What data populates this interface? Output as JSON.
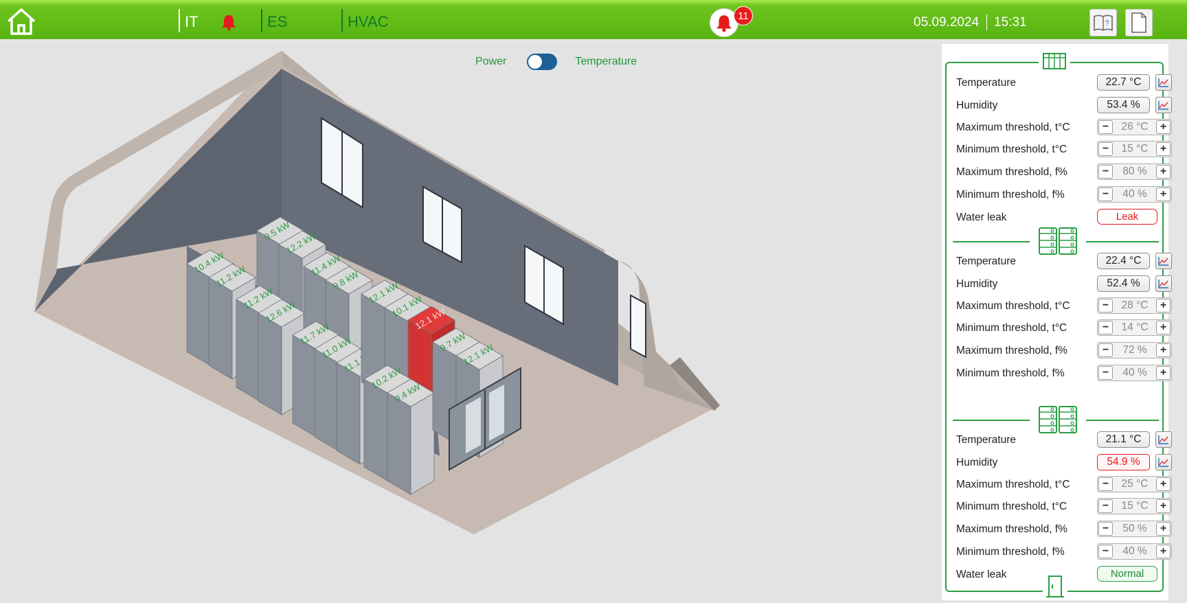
{
  "topbar": {
    "nav": [
      {
        "label": "IT",
        "color": "#ffffff"
      },
      {
        "label": "ES",
        "color": "#127a2a"
      },
      {
        "label": "HVAC",
        "color": "#127a2a"
      }
    ],
    "alarm_count": "11",
    "date": "05.09.2024",
    "time": "15:31",
    "icons": {
      "home": "home-icon",
      "alarm": "bell-icon",
      "help": "help-book-icon",
      "report": "document-icon"
    }
  },
  "view_toggle": {
    "left_label": "Power",
    "right_label": "Temperature",
    "state": "power"
  },
  "racks": [
    {
      "id": "r1",
      "label": "10.4 kW",
      "alert": false
    },
    {
      "id": "r2",
      "label": "11.2 kW",
      "alert": false
    },
    {
      "id": "r3",
      "label": "9.5 kW",
      "alert": false
    },
    {
      "id": "r4",
      "label": "12.2 kW",
      "alert": false
    },
    {
      "id": "r5",
      "label": "11.2 kW",
      "alert": false
    },
    {
      "id": "r6",
      "label": "12.6 kW",
      "alert": false
    },
    {
      "id": "r7",
      "label": "11.4 kW",
      "alert": false
    },
    {
      "id": "r8",
      "label": "9.8 kW",
      "alert": false
    },
    {
      "id": "r9",
      "label": "11.7 kW",
      "alert": false
    },
    {
      "id": "r10",
      "label": "11.0 kW",
      "alert": false
    },
    {
      "id": "r11",
      "label": "11.1 kW",
      "alert": false
    },
    {
      "id": "r12",
      "label": "12.1 kW",
      "alert": false
    },
    {
      "id": "r13",
      "label": "10.1 kW",
      "alert": false
    },
    {
      "id": "r14",
      "label": "12.1 kW",
      "alert": true
    },
    {
      "id": "r15",
      "label": "10.2 kW",
      "alert": false
    },
    {
      "id": "r16",
      "label": "9.4 kW",
      "alert": false
    },
    {
      "id": "r17",
      "label": "9.7 kW",
      "alert": false
    },
    {
      "id": "r18",
      "label": "12.1 kW",
      "alert": false
    }
  ],
  "panel": {
    "sections": [
      {
        "icon": "room-grid-icon",
        "temperature": "22.7 °C",
        "humidity": "53.4 %",
        "humidity_alert": false,
        "max_t": "26 °C",
        "min_t": "15 °C",
        "max_h": "80 %",
        "min_h": "40 %",
        "water_leak": "Leak",
        "leak_alert": true
      },
      {
        "icon": "rack-pair-icon",
        "temperature": "22.4 °C",
        "humidity": "52.4 %",
        "humidity_alert": false,
        "max_t": "28 °C",
        "min_t": "14 °C",
        "max_h": "72 %",
        "min_h": "40 %"
      },
      {
        "icon": "rack-pair-icon",
        "temperature": "21.1 °C",
        "humidity": "54.9 %",
        "humidity_alert": true,
        "max_t": "25 °C",
        "min_t": "15 °C",
        "max_h": "50 %",
        "min_h": "40 %",
        "water_leak": "Normal",
        "leak_alert": false
      }
    ],
    "labels": {
      "temperature": "Temperature",
      "humidity": "Humidity",
      "max_t": "Maximum threshold, t°C",
      "min_t": "Minimum threshold, t°C",
      "max_h": "Maximum threshold, f%",
      "min_h": "Minimum threshold, f%",
      "water_leak": "Water leak"
    },
    "stepper": {
      "minus": "−",
      "plus": "+"
    },
    "footer_icon": "door-icon",
    "colors": {
      "accent": "#2a9d45",
      "alert": "#e11b1b"
    }
  }
}
